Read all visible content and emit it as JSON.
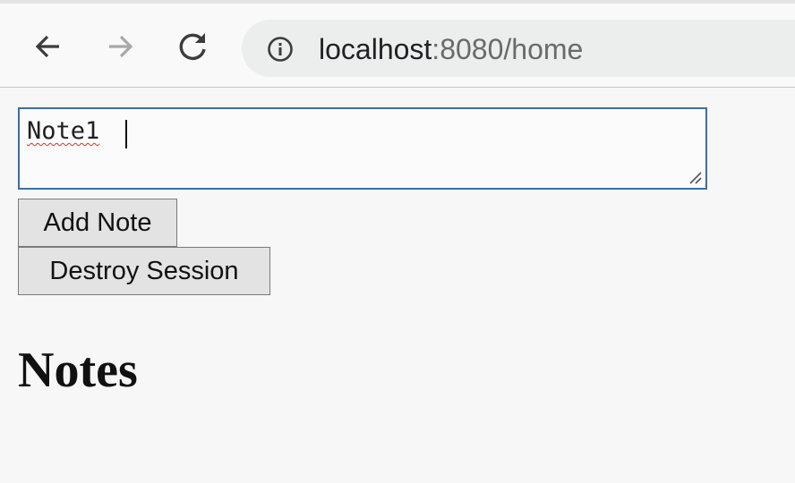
{
  "browser": {
    "url_host": "localhost",
    "url_rest": ":8080/home",
    "icons": {
      "back": "arrow-left-icon",
      "forward": "arrow-right-icon",
      "reload": "reload-icon",
      "site_info": "info-icon"
    }
  },
  "form": {
    "note_value": "Note1",
    "add_button_label": "Add Note",
    "destroy_button_label": "Destroy Session"
  },
  "notes": {
    "heading": "Notes"
  },
  "colors": {
    "focus_border": "#3b6ea5",
    "spellcheck_underline": "#d93030"
  }
}
